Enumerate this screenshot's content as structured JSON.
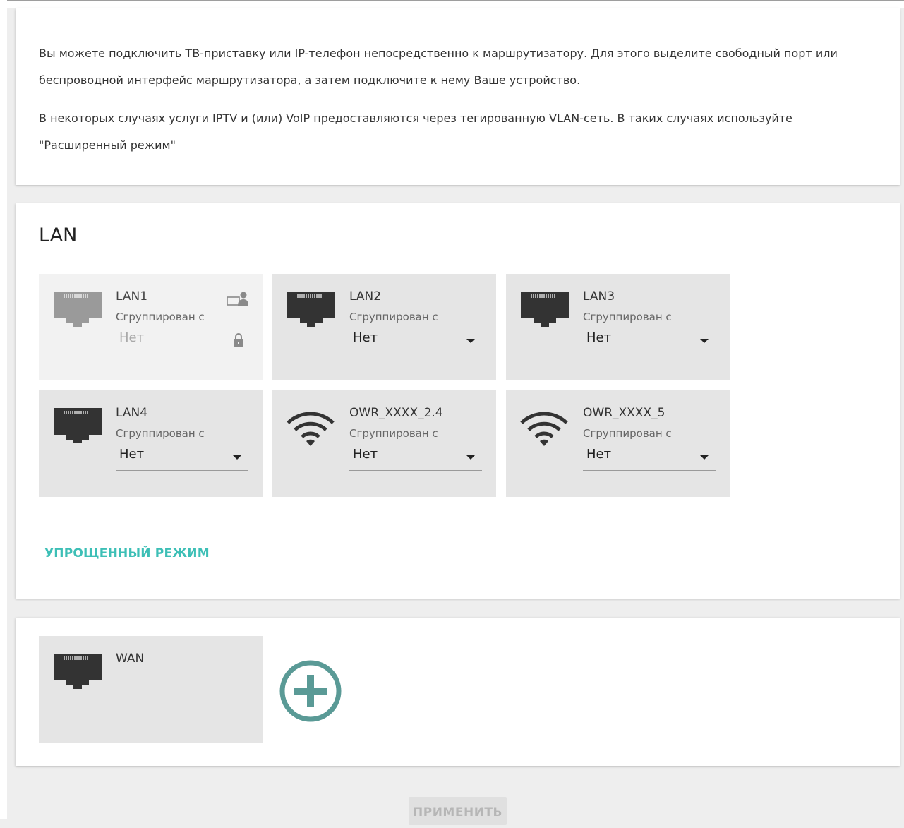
{
  "info": {
    "paragraph1": "Вы можете подключить ТВ-приставку или IP-телефон непосредственно к маршрутизатору. Для этого выделите свободный порт или беспроводной интерфейс маршрутизатора, а затем подключите к нему Ваше устройство.",
    "paragraph2": "В некоторых случаях услуги IPTV и (или) VoIP предоставляются через тегированную VLAN-сеть. В таких случаях используйте \"Расширенный режим\""
  },
  "lan": {
    "title": "LAN",
    "grouped_label": "Сгруппирован с",
    "tiles": [
      {
        "name": "LAN1",
        "icon": "ethernet-port-icon",
        "value": "Нет",
        "disabled": true
      },
      {
        "name": "LAN2",
        "icon": "ethernet-port-icon",
        "value": "Нет",
        "disabled": false
      },
      {
        "name": "LAN3",
        "icon": "ethernet-port-icon",
        "value": "Нет",
        "disabled": false
      },
      {
        "name": "LAN4",
        "icon": "ethernet-port-icon",
        "value": "Нет",
        "disabled": false
      },
      {
        "name": "OWR_XXXX_2.4",
        "icon": "wifi-icon",
        "value": "Нет",
        "disabled": false
      },
      {
        "name": "OWR_XXXX_5",
        "icon": "wifi-icon",
        "value": "Нет",
        "disabled": false
      }
    ],
    "simple_mode_label": "УПРОЩЕННЫЙ РЕЖИМ"
  },
  "wan": {
    "tile_name": "WAN",
    "icon": "ethernet-port-icon",
    "add_icon": "plus-circle-icon"
  },
  "apply_label": "ПРИМЕНИТЬ",
  "colors": {
    "accent": "#3dbfb6",
    "add_button": "#5a9a96",
    "port_icon": "#333333",
    "port_icon_disabled": "#9a9a9a"
  }
}
